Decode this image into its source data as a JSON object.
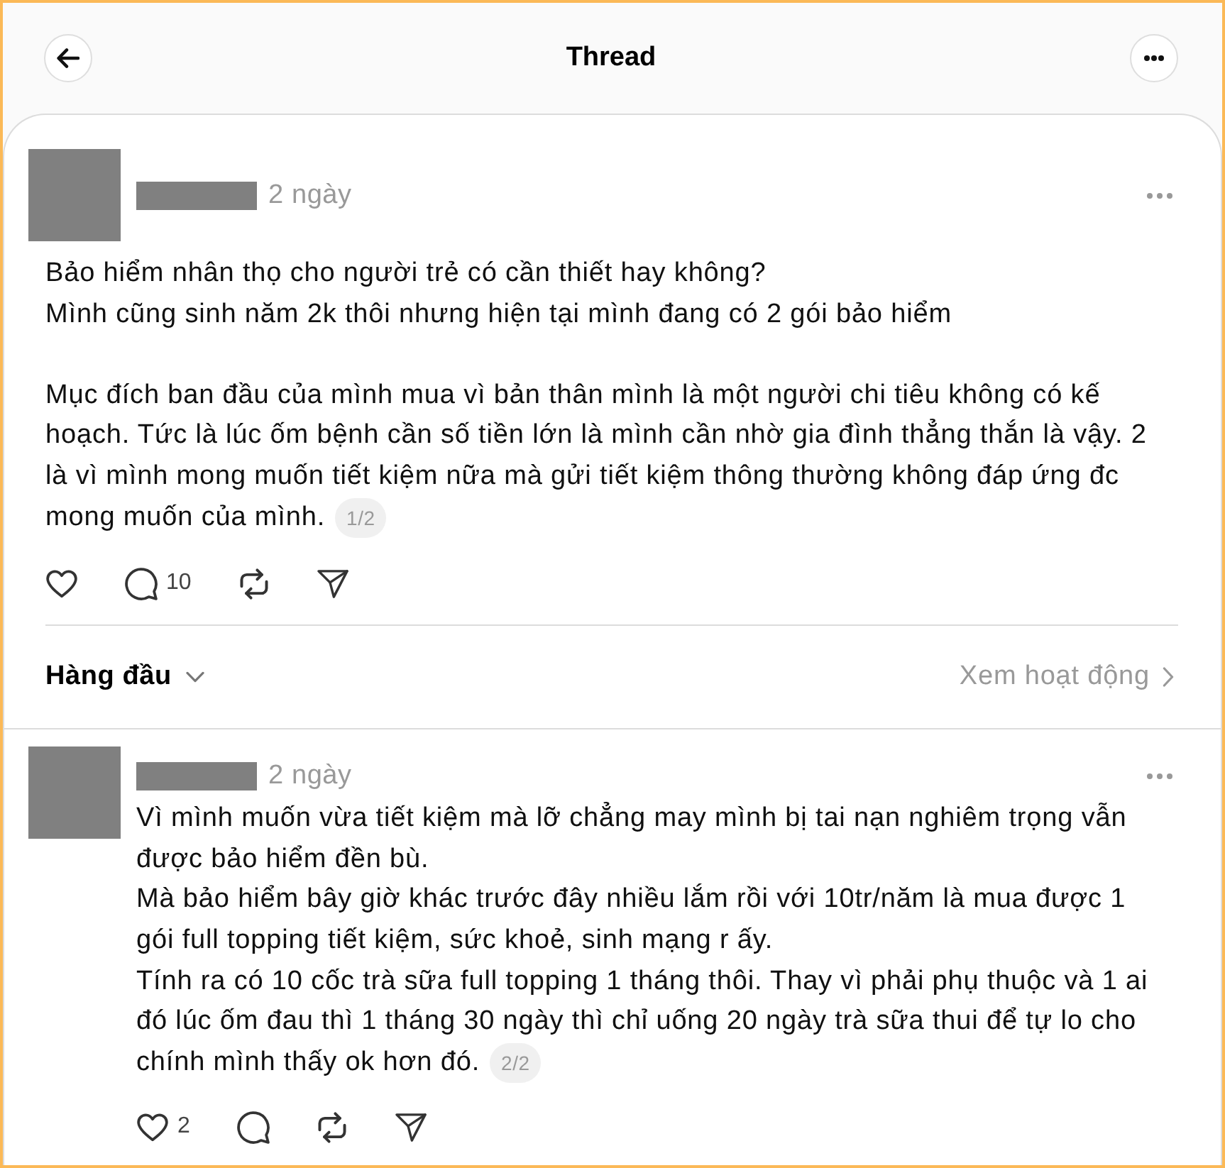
{
  "header": {
    "title": "Thread"
  },
  "main_post": {
    "time": "2 ngày",
    "text": "Bảo hiểm nhân thọ cho người trẻ có cần thiết hay không?\nMình cũng sinh năm 2k thôi nhưng hiện tại mình đang có 2 gói bảo hiểm\n\nMục đích ban đầu của mình mua vì bản thân mình là một người chi tiêu không có kế\nhoạch. Tức là lúc ốm bệnh cần số tiền lớn là mình cần nhờ gia đình thẳng thắn là vậy. 2\nlà vì mình mong muốn tiết kiệm nữa mà gửi tiết kiệm thông thường không đáp ứng đc\nmong muốn của mình.",
    "page_indicator": "1/2",
    "actions": [
      {
        "kind": "like"
      },
      {
        "kind": "reply",
        "count": "10"
      },
      {
        "kind": "repost"
      },
      {
        "kind": "share"
      }
    ]
  },
  "sort_bar": {
    "sort_label": "Hàng đầu",
    "activity_link": "Xem hoạt động"
  },
  "replies": [
    {
      "time": "2 ngày",
      "text": "Vì mình muốn vừa tiết kiệm mà lỡ chẳng may mình bị tai nạn nghiêm trọng vẫn\nđược bảo hiểm đền bù.\nMà bảo hiểm bây giờ khác trước đây nhiều lắm rồi với 10tr/năm là mua được 1\ngói full topping tiết kiệm, sức khoẻ, sinh mạng r ấy.\nTính ra có 10 cốc trà sữa full topping 1 tháng thôi. Thay vì phải phụ thuộc và 1 ai\nđó lúc ốm đau thì 1 tháng 30 ngày thì chỉ uống 20 ngày trà sữa thui để tự lo cho\nchính mình thấy ok hơn đó.",
      "page_indicator": "2/2",
      "actions": [
        {
          "kind": "like",
          "count": "2"
        },
        {
          "kind": "reply"
        },
        {
          "kind": "repost"
        },
        {
          "kind": "share"
        }
      ]
    }
  ]
}
